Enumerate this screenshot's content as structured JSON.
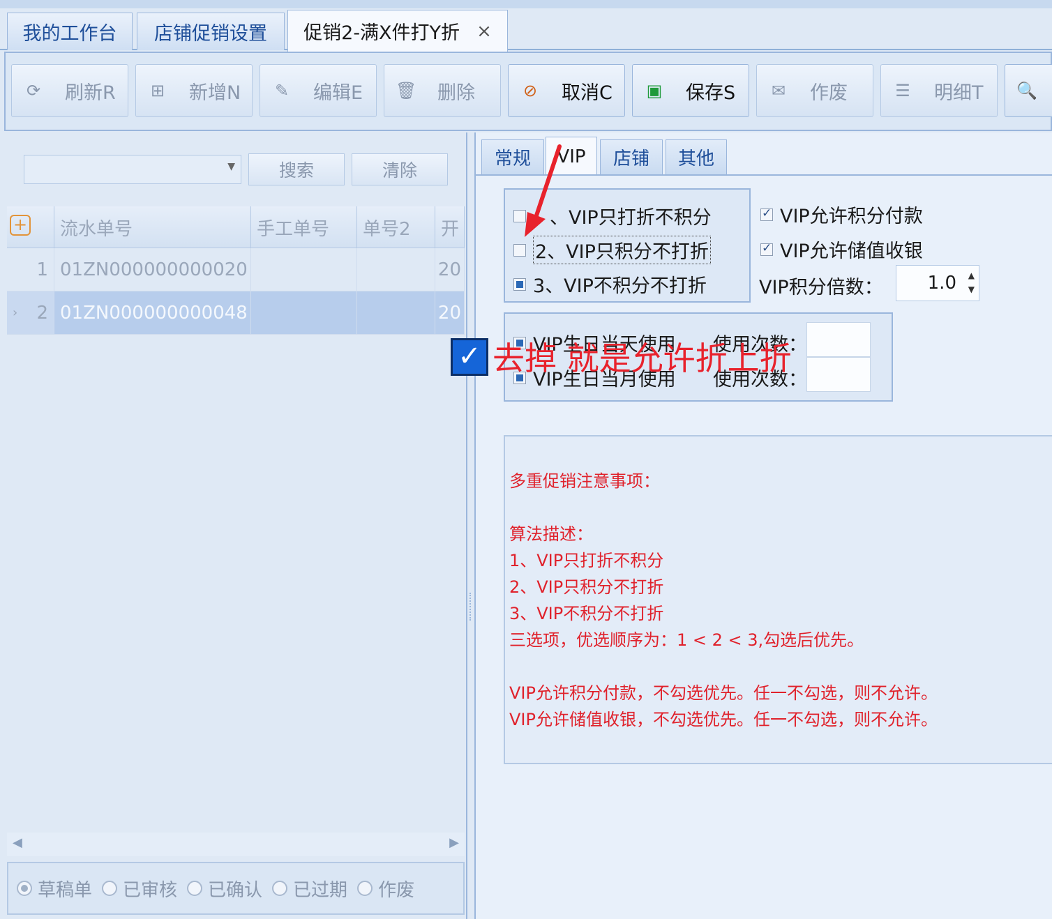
{
  "doc_tabs": [
    "我的工作台",
    "店铺促销设置",
    "促销2-满X件打Y折"
  ],
  "close_glyph": "×",
  "toolbar": [
    {
      "label": "刷新R",
      "icon": "refresh-icon",
      "glyph": "⟳",
      "enabled": false
    },
    {
      "label": "新增N",
      "icon": "add-icon",
      "glyph": "⊞",
      "enabled": false
    },
    {
      "label": "编辑E",
      "icon": "edit-icon",
      "glyph": "✎",
      "enabled": false
    },
    {
      "label": "删除",
      "icon": "delete-icon",
      "glyph": "🗑",
      "enabled": false
    },
    {
      "label": "取消C",
      "icon": "cancel-icon",
      "glyph": "⊘",
      "enabled": true
    },
    {
      "label": "保存S",
      "icon": "save-icon",
      "glyph": "▣",
      "enabled": true
    },
    {
      "label": "作废",
      "icon": "void-icon",
      "glyph": "✉",
      "enabled": false
    },
    {
      "label": "明细T",
      "icon": "detail-icon",
      "glyph": "☰",
      "enabled": false
    },
    {
      "label": "",
      "icon": "search-doc-icon",
      "glyph": "🔍",
      "enabled": true
    }
  ],
  "left": {
    "search_label": "搜索",
    "clear_label": "清除",
    "columns": [
      "流水单号",
      "手工单号",
      "单号2",
      "开"
    ],
    "rows": [
      {
        "num": "1",
        "serial": "01ZN000000000020",
        "manual": "",
        "no2": "",
        "start": "20"
      },
      {
        "num": "2",
        "serial": "01ZN000000000048",
        "manual": "",
        "no2": "",
        "start": "20"
      }
    ],
    "statuses": [
      "草稿单",
      "已审核",
      "已确认",
      "已过期",
      "作废"
    ],
    "selected_status": "草稿单"
  },
  "right": {
    "tabs": [
      "常规",
      "VIP",
      "店铺",
      "其他"
    ],
    "active_tab": "VIP",
    "vip_options": [
      "、VIP只打折不积分",
      "2、VIP只积分不打折",
      "3、VIP不积分不打折"
    ],
    "vip_allow_points": "VIP允许积分付款",
    "vip_allow_stored": "VIP允许储值收银",
    "points_multiplier_label": "VIP积分倍数：",
    "points_multiplier": "1.0",
    "birthday_day": "VIP生日当天使用",
    "birthday_month": "VIP生日当月使用",
    "use_count_label": "使用次数：",
    "notes": [
      "多重促销注意事项：",
      "算法描述：",
      "1、VIP只打折不积分",
      "2、VIP只积分不打折",
      "3、VIP不积分不打折",
      " 三选项，优选顺序为：1 < 2 < 3,勾选后优先。",
      "VIP允许积分付款，不勾选优先。任一不勾选，则不允许。",
      "VIP允许储值收银，不勾选优先。任一不勾选，则不允许。"
    ]
  },
  "annotation": {
    "check_glyph": "✓",
    "text": "去掉 就是允许折上折",
    "color": "#e8222c"
  }
}
